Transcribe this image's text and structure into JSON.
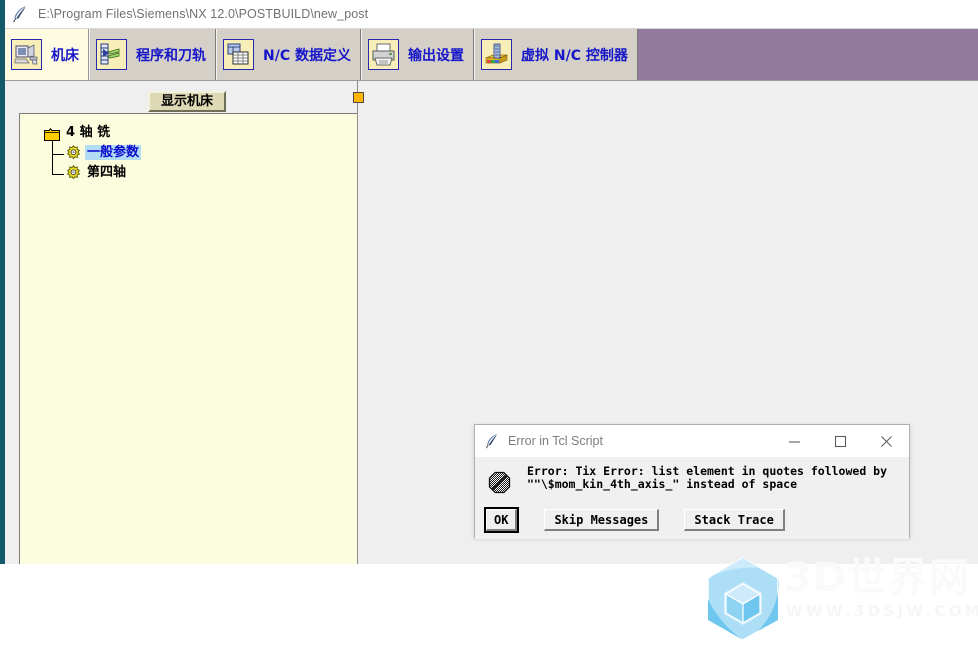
{
  "window": {
    "title": "E:\\Program Files\\Siemens\\NX 12.0\\POSTBUILD\\new_post",
    "icon": "quill-icon"
  },
  "tabs": [
    {
      "label": "机床",
      "icon": "machine-icon",
      "selected": true
    },
    {
      "label": "程序和刀轨",
      "icon": "program-toolpath-icon",
      "selected": false
    },
    {
      "label": "N/C 数据定义",
      "icon": "nc-data-definition-icon",
      "selected": false
    },
    {
      "label": "输出设置",
      "icon": "printer-icon",
      "selected": false
    },
    {
      "label": "虚拟 N/C 控制器",
      "icon": "virtual-nc-controller-icon",
      "selected": false
    }
  ],
  "toolbar": {
    "show_machine_label": "显示机床"
  },
  "tree": {
    "root": {
      "label": "4 轴 铣",
      "icon": "folder-icon"
    },
    "children": [
      {
        "label": "一般参数",
        "icon": "gear-icon",
        "selected": true
      },
      {
        "label": "第四轴",
        "icon": "gear-icon",
        "selected": false
      }
    ]
  },
  "dialog": {
    "title": "Error in Tcl Script",
    "icon": "quill-icon",
    "window_buttons": {
      "minimize": "minimize-icon",
      "maximize": "maximize-icon",
      "close": "close-icon"
    },
    "message_icon": "error-octagon-icon",
    "message_line1": "Error: Tix Error: list element in quotes followed by",
    "message_line2": "\"\"\\$mom_kin_4th_axis_\" instead of space",
    "buttons": [
      {
        "label": "OK",
        "focused": true
      },
      {
        "label": "Skip Messages",
        "focused": false
      },
      {
        "label": "Stack Trace",
        "focused": false
      }
    ]
  },
  "watermark": {
    "title": "3D世界网",
    "url": "WWW.3DSJW.COM"
  },
  "colors": {
    "accent_teal": "#14596b",
    "tab_filler_purple": "#927a9e",
    "tab_selected": "#fdfbe2",
    "tree_background": "#fcfcde",
    "selection_blue": "#b3ddf2",
    "label_blue": "#1616c8",
    "sash_orange": "#ffb400"
  }
}
